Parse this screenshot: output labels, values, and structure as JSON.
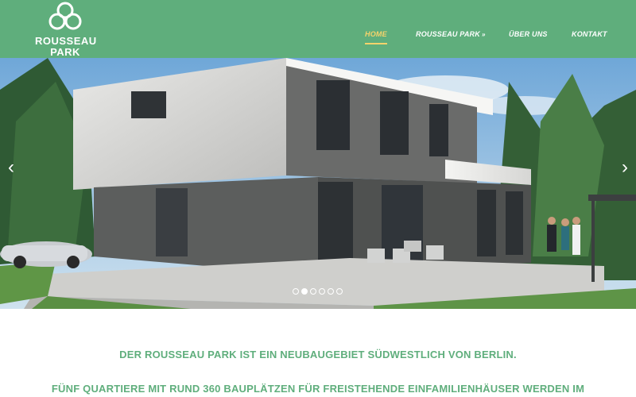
{
  "brand": {
    "name_line1": "ROUSSEAU",
    "name_line2": "PARK"
  },
  "nav": {
    "items": [
      {
        "label": "HOME",
        "active": true
      },
      {
        "label": "ROUSSEAU PARK",
        "has_dropdown": true
      },
      {
        "label": "ÜBER UNS"
      },
      {
        "label": "KONTAKT"
      }
    ],
    "dropdown_glyph": "»"
  },
  "slider": {
    "prev_glyph": "‹",
    "next_glyph": "›",
    "slide_count": 6,
    "active_slide": 2
  },
  "content": {
    "headline": "DER ROUSSEAU PARK IST EIN NEUBAUGEBIET SÜDWESTLICH VON BERLIN.",
    "subline": "FÜNF QUARTIERE MIT RUND 360 BAUPLÄTZEN FÜR FREISTEHENDE EINFAMILIENHÄUSER WERDEN IM"
  },
  "colors": {
    "brand_green": "#5fae7c",
    "nav_active": "#f6d36b"
  }
}
